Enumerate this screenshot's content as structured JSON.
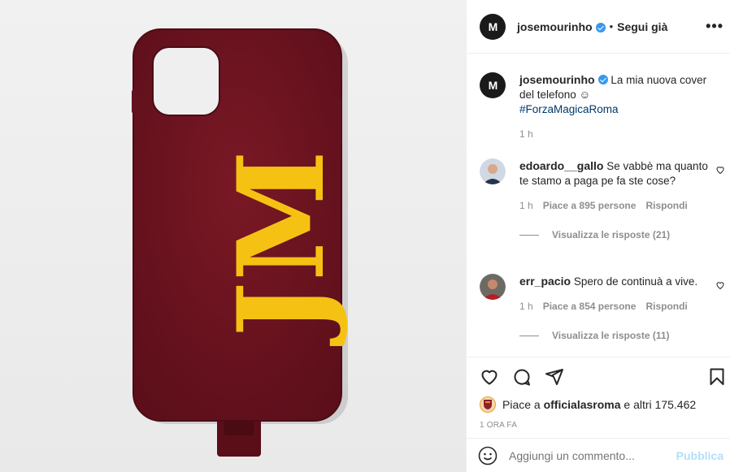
{
  "post": {
    "username": "josemourinho",
    "avatar_initials": "M",
    "follow_state": "Segui già",
    "more_label": "•••",
    "separator": "•"
  },
  "media": {
    "monogram": "JM",
    "case_color": "#6e1420",
    "letter_color": "#f5c213"
  },
  "caption": {
    "username": "josemourinho",
    "text": "La mia nuova cover del telefono ☺",
    "hashtag": "#ForzaMagicaRoma",
    "time": "1 h"
  },
  "comments": [
    {
      "username": "edoardo__gallo",
      "text": "Se vabbè ma quanto te stamo a paga pe fa ste cose?",
      "time": "1 h",
      "likes": "Piace a 895 persone",
      "reply": "Rispondi",
      "view_replies": "Visualizza le risposte (21)"
    },
    {
      "username": "err_pacio",
      "text": "Spero de continuà a vive.",
      "time": "1 h",
      "likes": "Piace a 854 persone",
      "reply": "Rispondi",
      "view_replies": "Visualizza le risposte (11)"
    }
  ],
  "likes": {
    "prefix": "Piace a",
    "liker": "officialasroma",
    "suffix": "e altri 175.462"
  },
  "timestamp": "1 ORA FA",
  "add_comment": {
    "placeholder": "Aggiungi un commento...",
    "post_label": "Pubblica"
  },
  "icons": {
    "like": "heart-icon",
    "comment": "comment-icon",
    "share": "share-icon",
    "save": "bookmark-icon",
    "emoji": "emoji-icon"
  }
}
